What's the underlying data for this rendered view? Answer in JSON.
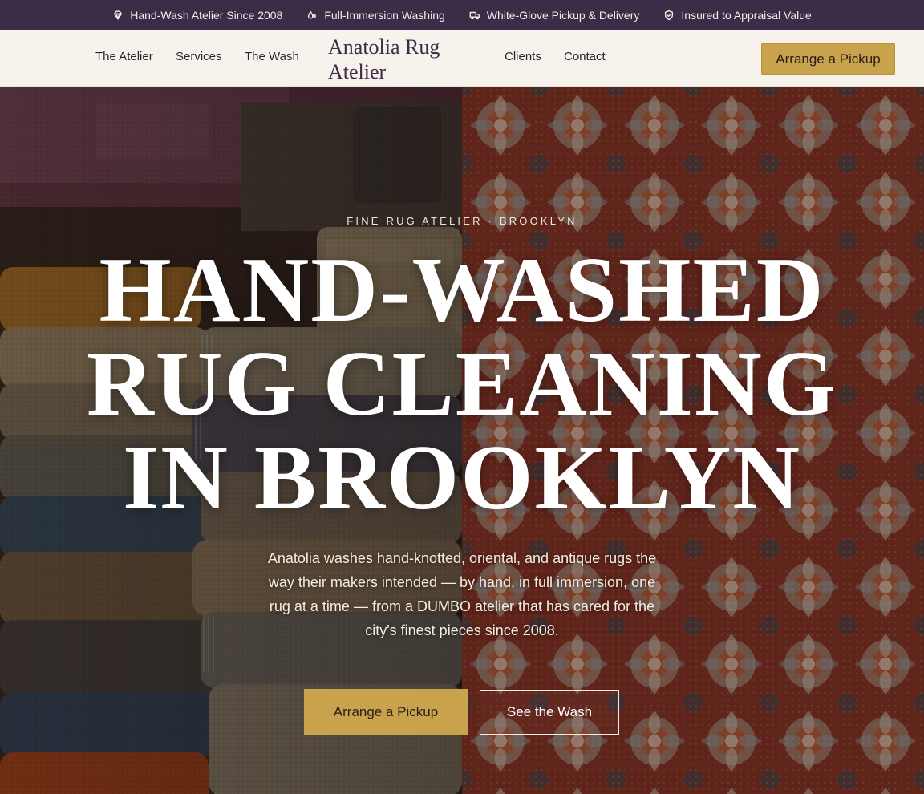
{
  "topbar": {
    "items": [
      {
        "icon": "diamond-icon",
        "label": "Hand-Wash Atelier Since 2008"
      },
      {
        "icon": "water-drops-icon",
        "label": "Full-Immersion Washing"
      },
      {
        "icon": "truck-icon",
        "label": "White-Glove Pickup & Delivery"
      },
      {
        "icon": "shield-icon",
        "label": "Insured to Appraisal Value"
      }
    ]
  },
  "header": {
    "brand": "Anatolia Rug Atelier",
    "nav": [
      "The Atelier",
      "Services",
      "The Wash",
      "Clients",
      "Contact"
    ],
    "cta": "Arrange a Pickup"
  },
  "hero": {
    "eyebrow": "FINE RUG ATELIER · BROOKLYN",
    "title_lines": [
      "HAND-WASHED",
      "RUG CLEANING",
      "IN BROOKLYN"
    ],
    "body": "Anatolia washes hand-knotted, oriental, and antique rugs the way their makers intended — by hand, in full immersion, one rug at a time — from a DUMBO atelier that has cared for the city's finest pieces since 2008.",
    "cta_primary": "Arrange a Pickup",
    "cta_secondary": "See the Wash",
    "left_image": "folded-rug-stack-photo",
    "right_image": "persian-rug-pattern-photo"
  },
  "colors": {
    "topbar_bg": "#3b2d47",
    "header_bg": "#f7f3ec",
    "accent_gold": "#c9a24e",
    "brand_purple": "#3b2d47",
    "rug_red": "#8d3526"
  }
}
